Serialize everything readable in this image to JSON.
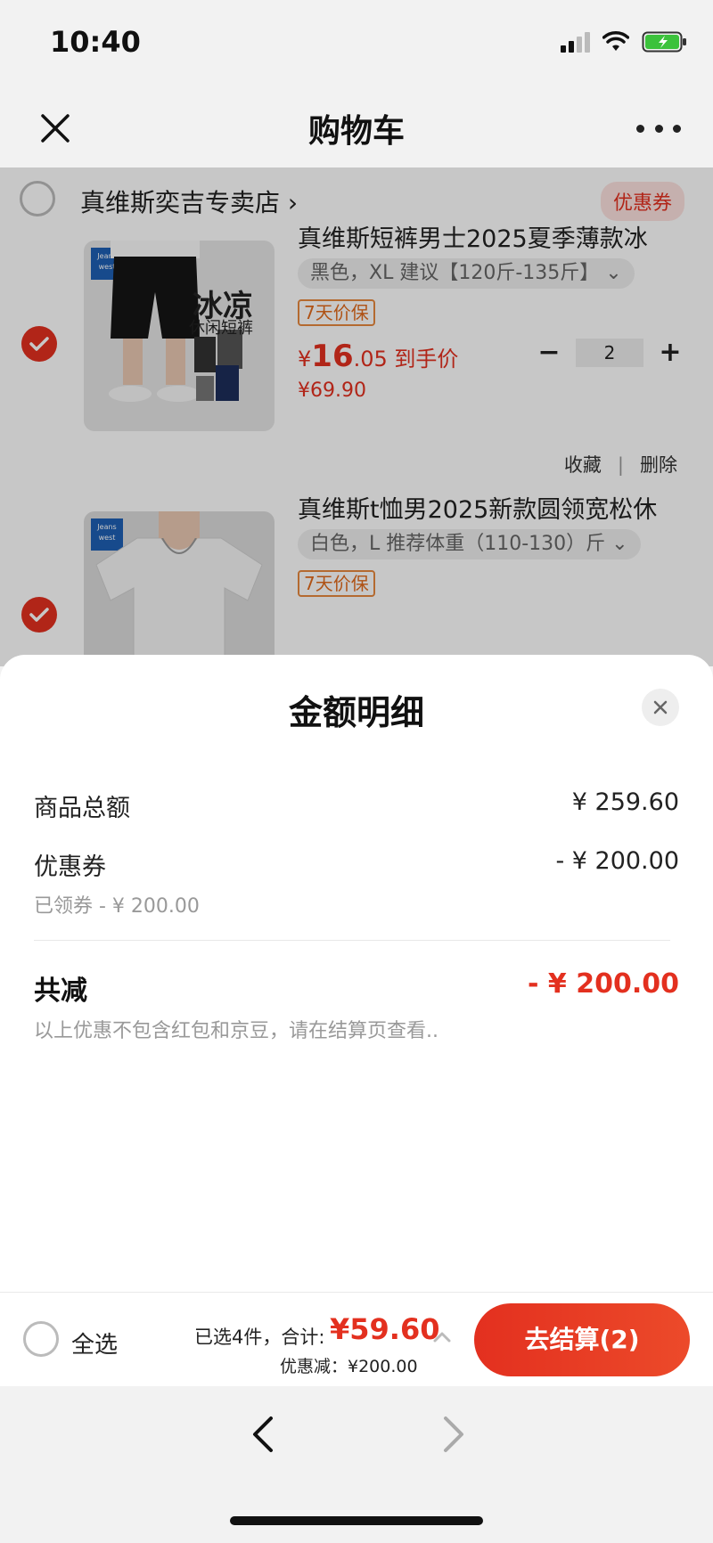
{
  "status_bar": {
    "time": "10:40"
  },
  "nav": {
    "title": "购物车"
  },
  "shop": {
    "name": "真维斯奕吉专卖店",
    "coupon_tag": "优惠券"
  },
  "items": [
    {
      "title": "真维斯短裤男士2025夏季薄款冰",
      "spec": "黑色，XL 建议【120斤-135斤】",
      "guarantee": "7天价保",
      "price_symbol": "¥",
      "price_big": "16",
      "price_small": ".05",
      "price_label": "到手价",
      "original_price": "¥69.90",
      "quantity": "2",
      "thumb_big_text": "冰凉",
      "thumb_sub_text": "休闲短裤",
      "collect_label": "收藏",
      "delete_label": "删除"
    },
    {
      "title": "真维斯t恤男2025新款圆领宽松休",
      "spec": "白色，L 推荐体重（110-130）斤",
      "guarantee": "7天价保"
    }
  ],
  "sheet": {
    "title": "金额明细",
    "goods_total_label": "商品总额",
    "goods_total_value": "¥ 259.60",
    "coupon_label": "优惠券",
    "coupon_value": "- ¥ 200.00",
    "coupon_sub": "已领券 - ¥ 200.00",
    "total_reduce_label": "共减",
    "total_reduce_value": "- ¥ 200.00",
    "note": "以上优惠不包含红包和京豆，请在结算页查看.."
  },
  "checkout": {
    "select_all_label": "全选",
    "summary_label": "已选4件，合计:",
    "total": "¥59.60",
    "discount_label": "优惠减：¥200.00",
    "button_label": "去结算(2)"
  },
  "colors": {
    "accent": "#e3301f",
    "guarantee": "#e06a1c"
  },
  "icons": {
    "close": "close-icon",
    "more": "more-icon",
    "check": "check-icon",
    "chevron_up": "chevron-up-icon",
    "back": "back-arrow-icon",
    "forward": "forward-arrow-icon"
  }
}
